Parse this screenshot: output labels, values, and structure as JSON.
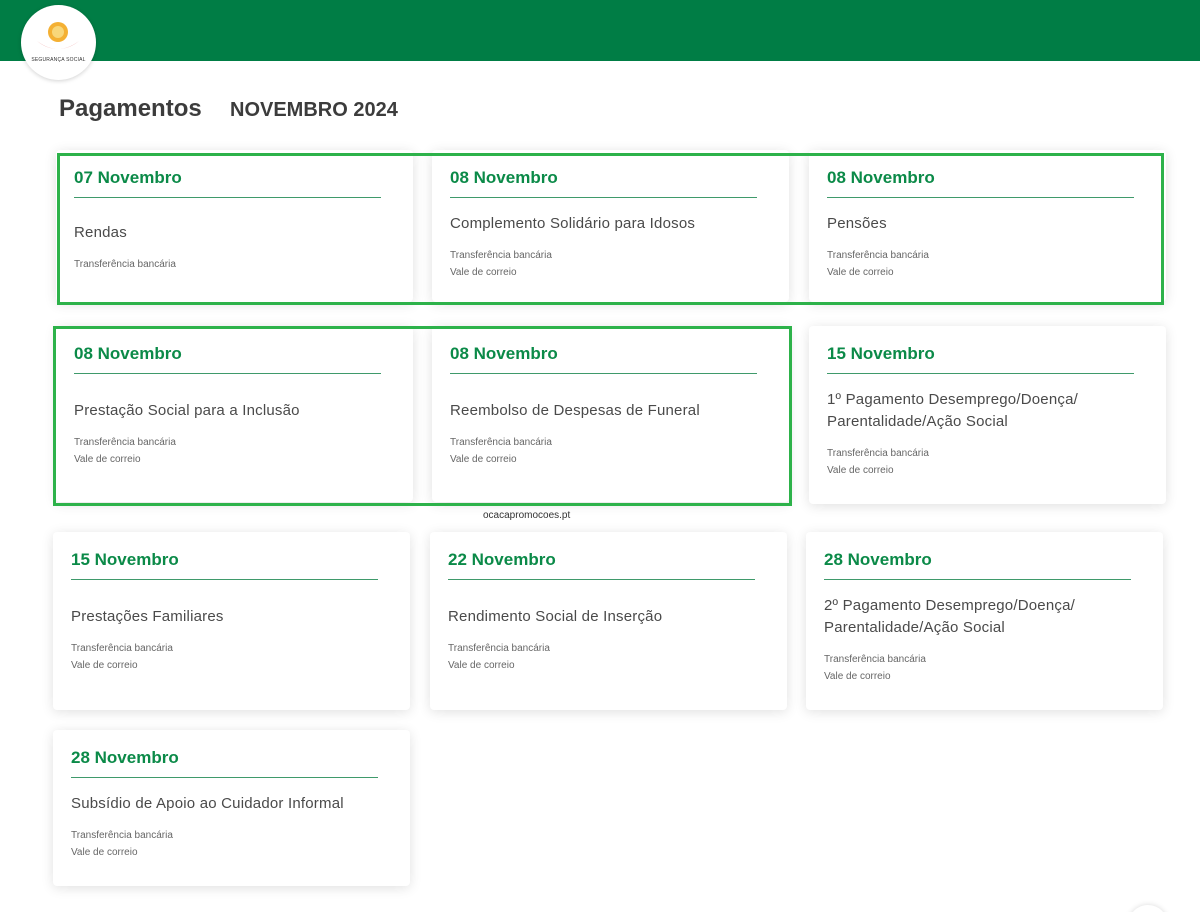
{
  "header": {
    "logo_text": "SEGURANÇA SOCIAL",
    "brand_color": "#007d45"
  },
  "page": {
    "title": "Pagamentos",
    "month": "NOVEMBRO 2024"
  },
  "watermark": "ocacapromocoes.pt",
  "cards": [
    {
      "date": "07 Novembro",
      "name": "Rendas",
      "methods": [
        "Transferência bancária"
      ]
    },
    {
      "date": "08 Novembro",
      "name": "Complemento Solidário para Idosos",
      "methods": [
        "Transferência bancária",
        "Vale de correio"
      ]
    },
    {
      "date": "08 Novembro",
      "name": "Pensões",
      "methods": [
        "Transferência bancária",
        "Vale de correio"
      ]
    },
    {
      "date": "08 Novembro",
      "name": "Prestação Social para a Inclusão",
      "methods": [
        "Transferência bancária",
        "Vale de correio"
      ]
    },
    {
      "date": "08 Novembro",
      "name": "Reembolso de Despesas de Funeral",
      "methods": [
        "Transferência bancária",
        "Vale de correio"
      ]
    },
    {
      "date": "15 Novembro",
      "name": "1º Pagamento Desemprego/Doença/ Parentalidade/Ação Social",
      "methods": [
        "Transferência bancária",
        "Vale de correio"
      ]
    },
    {
      "date": "15 Novembro",
      "name": "Prestações Familiares",
      "methods": [
        "Transferência bancária",
        "Vale de correio"
      ]
    },
    {
      "date": "22 Novembro",
      "name": "Rendimento Social de Inserção",
      "methods": [
        "Transferência bancária",
        "Vale de correio"
      ]
    },
    {
      "date": "28 Novembro",
      "name": "2º Pagamento Desemprego/Doença/ Parentalidade/Ação Social",
      "methods": [
        "Transferência bancária",
        "Vale de correio"
      ]
    },
    {
      "date": "28 Novembro",
      "name": "Subsídio de Apoio ao Cuidador Informal",
      "methods": [
        "Transferência bancária",
        "Vale de correio"
      ]
    }
  ]
}
